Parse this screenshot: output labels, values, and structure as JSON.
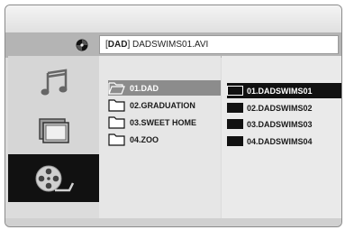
{
  "path": {
    "folder_tag": "DAD",
    "file": "DADSWIMS01.AVI"
  },
  "categories": [
    {
      "name": "music",
      "icon": "music-note-icon"
    },
    {
      "name": "photo",
      "icon": "photo-icon"
    },
    {
      "name": "video",
      "icon": "film-reel-icon",
      "selected": true
    }
  ],
  "folders": [
    {
      "label": "01.DAD",
      "selected": true
    },
    {
      "label": "02.GRADUATION"
    },
    {
      "label": "03.SWEET HOME"
    },
    {
      "label": "04.ZOO"
    }
  ],
  "files": [
    {
      "label": "01.DADSWIMS01",
      "selected": true
    },
    {
      "label": "02.DADSWIMS02"
    },
    {
      "label": "03.DADSWIMS03"
    },
    {
      "label": "04.DADSWIMS04"
    }
  ]
}
